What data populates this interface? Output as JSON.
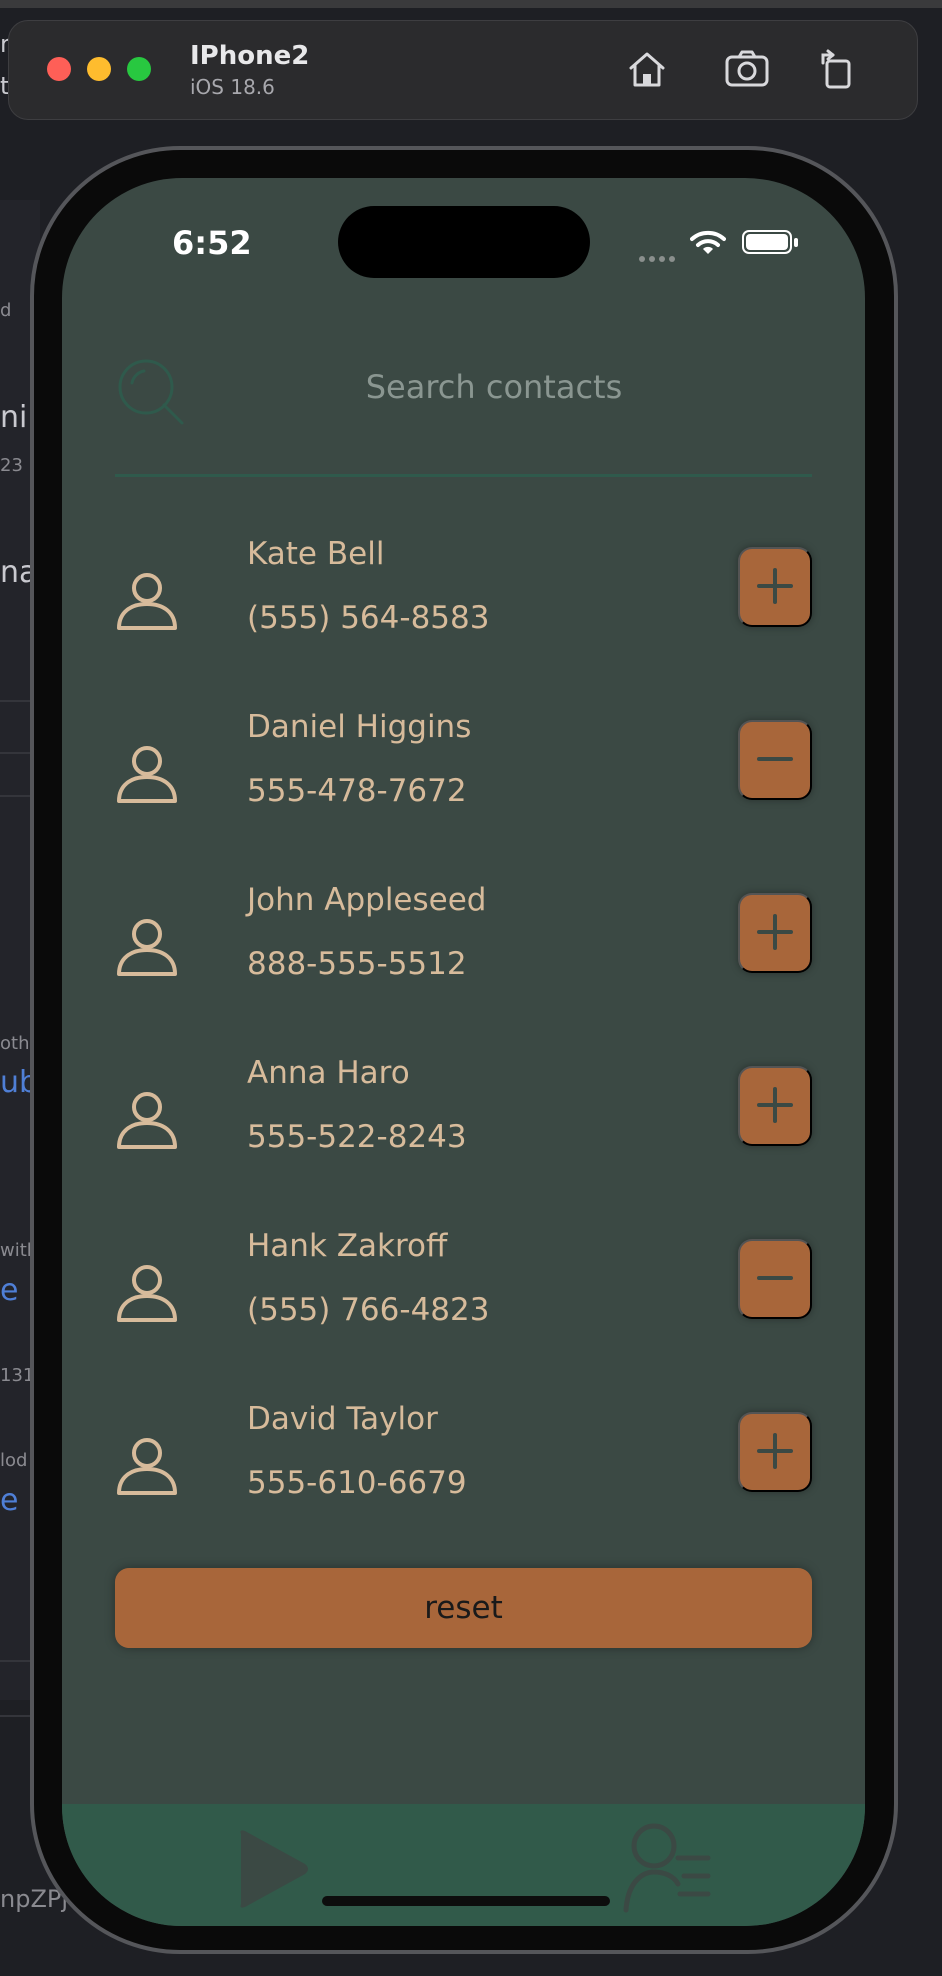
{
  "simulator": {
    "device_name": "IPhone2",
    "os_version": "iOS 18.6",
    "toolbar": [
      "home-icon",
      "screenshot-icon",
      "rotate-icon"
    ]
  },
  "background_window": {
    "fragments": [
      "r",
      "t",
      "d",
      "nil",
      "23",
      "na",
      "oth",
      "ub",
      "with",
      "e F",
      "131",
      "lod",
      "e F",
      "npZPj"
    ]
  },
  "status_bar": {
    "time": "6:52"
  },
  "search": {
    "placeholder": "Search contacts",
    "value": ""
  },
  "contacts": [
    {
      "name": "Kate Bell",
      "phone": "(555) 564-8583",
      "action": "add"
    },
    {
      "name": "Daniel Higgins",
      "phone": "555-478-7672",
      "action": "remove"
    },
    {
      "name": "John Appleseed",
      "phone": "888-555-5512",
      "action": "add"
    },
    {
      "name": "Anna Haro",
      "phone": "555-522-8243",
      "action": "add"
    },
    {
      "name": "Hank Zakroff",
      "phone": "(555) 766-4823",
      "action": "remove"
    },
    {
      "name": "David Taylor",
      "phone": "555-610-6679",
      "action": "add"
    }
  ],
  "reset_label": "reset",
  "tab_bar": {
    "tabs": [
      "play-icon",
      "contacts-list-icon"
    ]
  },
  "colors": {
    "screen_bg": "#3b4944",
    "accent": "#a8663a",
    "text": "#d7bb9b",
    "tab_bar": "#315a4a",
    "search_line": "#2f5a4c"
  }
}
